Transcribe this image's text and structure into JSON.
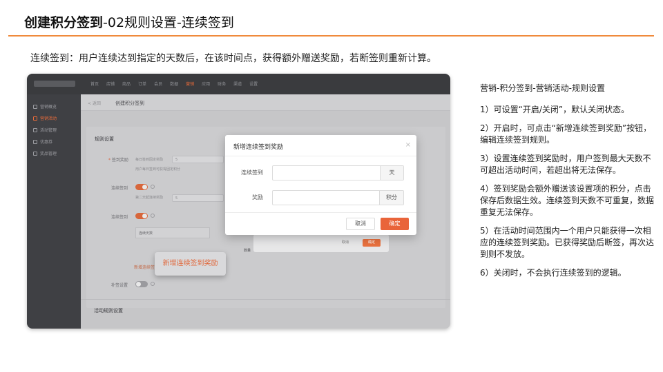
{
  "slide": {
    "title_bold": "创建积分签到",
    "title_rest": "-02规则设置-连续签到",
    "subtitle": "连续签到：用户连续达到指定的天数后，在该时间点，获得额外赠送奖励，若断签则重新计算。",
    "accent_color": "#f08a3c"
  },
  "app": {
    "top_nav": [
      "首页",
      "店铺",
      "商品",
      "订单",
      "会员",
      "数据",
      "营销",
      "应用",
      "财务",
      "渠道",
      "设置"
    ],
    "active_nav": "营销",
    "sidebar": [
      {
        "label": "营销概览",
        "icon": "chart-icon"
      },
      {
        "label": "营销活动",
        "icon": "gift-icon"
      },
      {
        "label": "活动管理",
        "icon": "calendar-icon"
      },
      {
        "label": "优惠券",
        "icon": "ticket-icon"
      },
      {
        "label": "奖品管理",
        "icon": "box-icon"
      }
    ],
    "breadcrumb_back": "< 返回",
    "page_title": "创建积分签到",
    "section_rules": "规则设置",
    "rows": {
      "daily_reward_label": "签到奖励",
      "daily_reward_text": "每日签到固定奖励",
      "daily_reward_value": "5",
      "hint": "用户每日签到可获得固定积分",
      "consecutive_label": "连续签到",
      "day2_text": "第二天起连续奖励",
      "day2_value": "5",
      "continuous_label": "连续签到",
      "continuous_days": "连续天数",
      "retro_label": "补签设置"
    },
    "orange_link": "新增连续签到",
    "back_dialog": {
      "cancel": "取消",
      "ok": "确定"
    },
    "back_label": "数量",
    "floating_button": "新增连续签到奖励",
    "section_activity": "活动规则设置"
  },
  "modal": {
    "title": "新增连续签到奖励",
    "close": "×",
    "field1_label": "连续签到",
    "field1_suffix": "天",
    "field2_label": "奖励",
    "field2_suffix": "积分",
    "cancel": "取消",
    "ok": "确定"
  },
  "notes": [
    "营销-积分签到-营销活动-规则设置",
    "1）可设置“开启/关闭”，默认关闭状态。",
    "2）开启时，可点击“新增连续签到奖励”按钮，编辑连续签到规则。",
    "3）设置连续签到奖励时，用户签到最大天数不可超出活动时间，若超出将无法保存。",
    "4）签到奖励会额外赠送该设置项的积分，点击保存后数据生效。连续签到天数不可重复，数据重复无法保存。",
    "5）在活动时间范围内一个用户只能获得一次相应的连续签到奖励。已获得奖励后断签，再次达到则不发放。",
    "6）关闭时，不会执行连续签到的逻辑。"
  ]
}
